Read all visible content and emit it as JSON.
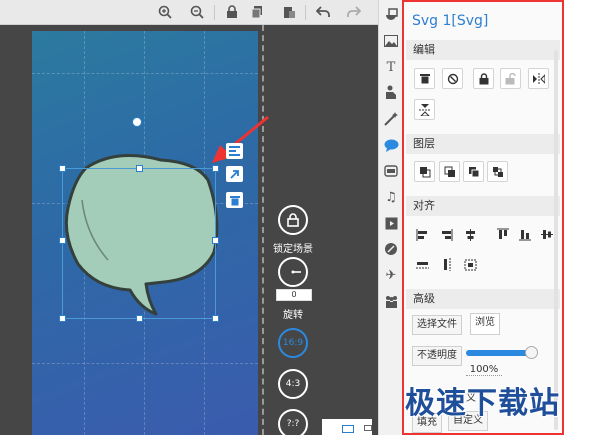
{
  "panel": {
    "title": "Svg 1[Svg]",
    "sections": {
      "edit": "编辑",
      "layer": "图层",
      "align": "对齐",
      "advanced": "高级"
    },
    "select_file": "选择文件",
    "browse": "浏览",
    "opacity_label": "不透明度",
    "opacity_value": "100%",
    "opacity_fraction": 0.9,
    "fill_label": "填充",
    "custom_label": "自定义",
    "partial_label": "义"
  },
  "controls": {
    "lock_scene": "锁定场景",
    "rotation_value": "0",
    "rotate": "旋转",
    "ratio_169": "16:9",
    "ratio_43": "4:3",
    "ratio_custom": "?:?"
  },
  "watermark": {
    "text": "极速下载站"
  },
  "colors": {
    "accent": "#2b8ae0",
    "highlight_border": "#ee3333",
    "bubble_fill": "#a3cdb8"
  },
  "icons": {
    "toolbar": [
      "zoom-in-icon",
      "zoom-out-icon",
      "lock-icon",
      "copy-icon",
      "paste-icon",
      "undo-icon",
      "redo-icon"
    ],
    "strip": [
      "shape-icon",
      "image-icon",
      "text-icon",
      "character-icon",
      "effects-icon",
      "speech-bubble-icon",
      "bubble-stack-icon",
      "music-icon",
      "video-icon",
      "rocket-icon",
      "plane-icon",
      "people-icon"
    ]
  }
}
